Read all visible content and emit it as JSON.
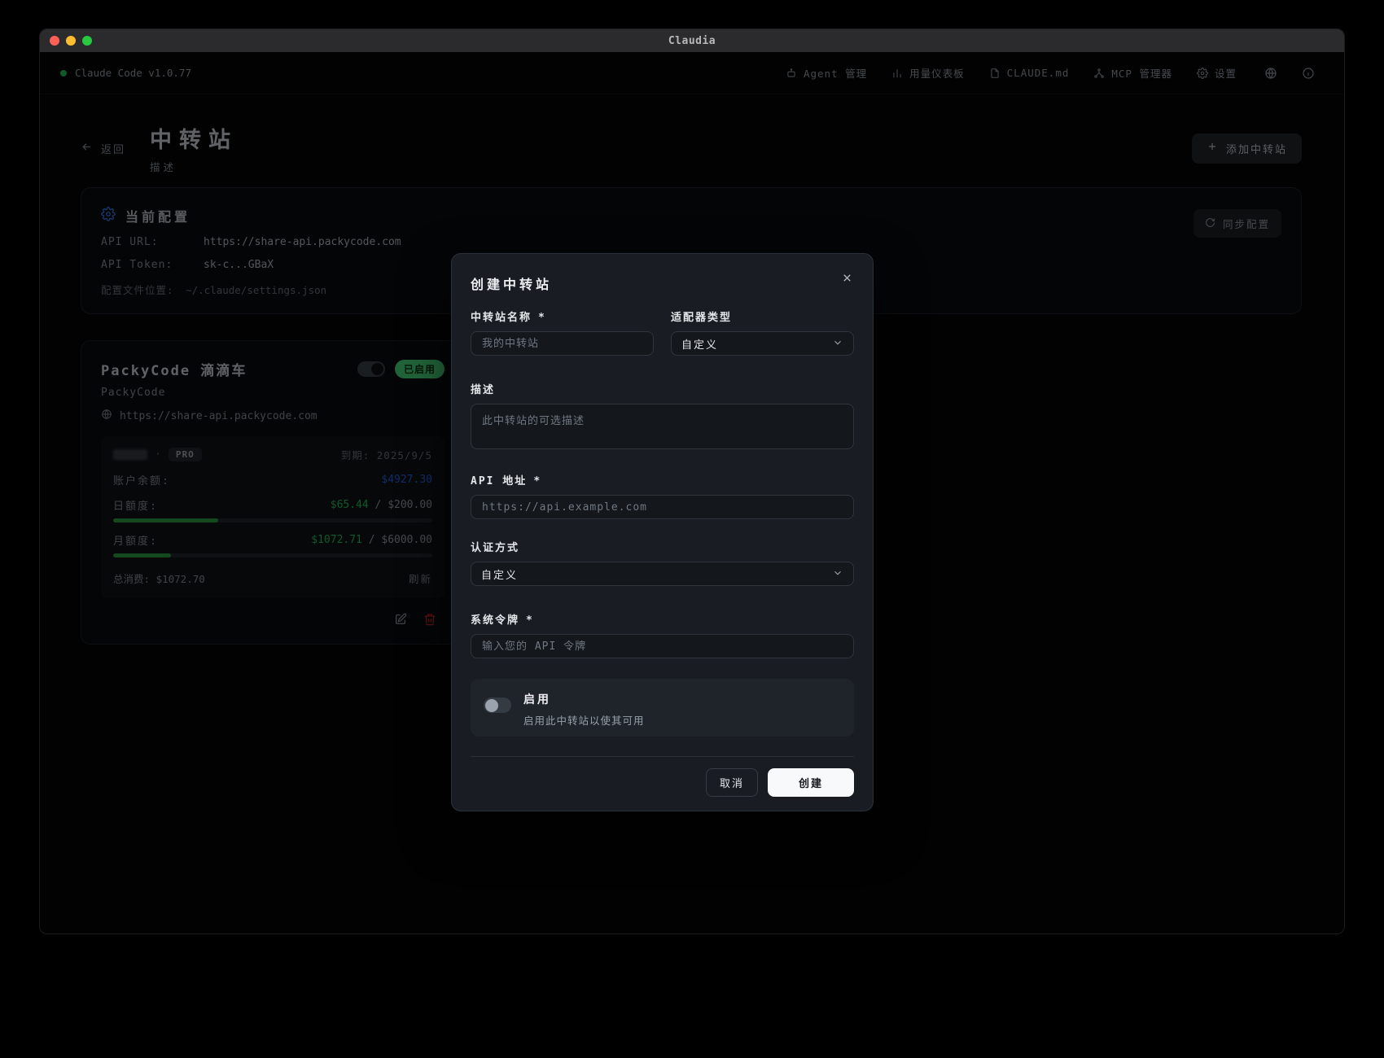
{
  "window": {
    "title": "Claudia"
  },
  "nav": {
    "brand": "Claude Code v1.0.77",
    "items": [
      {
        "label": "Agent 管理"
      },
      {
        "label": "用量仪表板"
      },
      {
        "label": "CLAUDE.md"
      },
      {
        "label": "MCP 管理器"
      },
      {
        "label": "设置"
      }
    ]
  },
  "header": {
    "back_label": "返回",
    "title": "中转站",
    "subtitle": "描述",
    "add_button_label": "添加中转站"
  },
  "config_card": {
    "title": "当前配置",
    "sync_button_label": "同步配置",
    "api_url_label": "API URL:",
    "api_url": "https://share-api.packycode.com",
    "api_token_label": "API Token:",
    "api_token": "sk-c...GBaX",
    "config_path_label": "配置文件位置:",
    "config_path": "~/.claude/settings.json"
  },
  "station_card": {
    "title": "PackyCode 滴滴车",
    "enabled_badge": "已启用",
    "provider": "PackyCode",
    "url": "https://share-api.packycode.com",
    "account_separator": "·",
    "plan_badge": "PRO",
    "expiry_label": "到期:",
    "expiry_date": "2025/9/5",
    "balance_label": "账户余额:",
    "balance_value": "$4927.30",
    "daily_label": "日额度:",
    "daily_used": "$65.44",
    "daily_separator": " / ",
    "daily_limit": "$200.00",
    "daily_percent": 33,
    "monthly_label": "月额度:",
    "monthly_used": "$1072.71",
    "monthly_separator": " / ",
    "monthly_limit": "$6000.00",
    "monthly_percent": 18,
    "total_label": "总消费:",
    "total_value": "$1072.70",
    "refresh_label": "刷新"
  },
  "modal": {
    "title": "创建中转站",
    "name_label": "中转站名称",
    "name_required": "*",
    "name_placeholder": "我的中转站",
    "adapter_label": "适配器类型",
    "adapter_value": "自定义",
    "desc_label": "描述",
    "desc_placeholder": "此中转站的可选描述",
    "api_label": "API 地址",
    "api_required": "*",
    "api_placeholder": "https://api.example.com",
    "auth_label": "认证方式",
    "auth_value": "自定义",
    "token_label": "系统令牌",
    "token_required": "*",
    "token_placeholder": "输入您的 API 令牌",
    "enable_label": "启用",
    "enable_desc": "启用此中转站以使其可用",
    "cancel_label": "取消",
    "create_label": "创建"
  },
  "colors": {
    "accent_blue": "#3b82f6",
    "balance_blue": "#2563eb",
    "money_green": "#22c55e",
    "badge_green": "#4ade80",
    "progress_green": "#2ea043",
    "danger_red": "#dc2626"
  }
}
